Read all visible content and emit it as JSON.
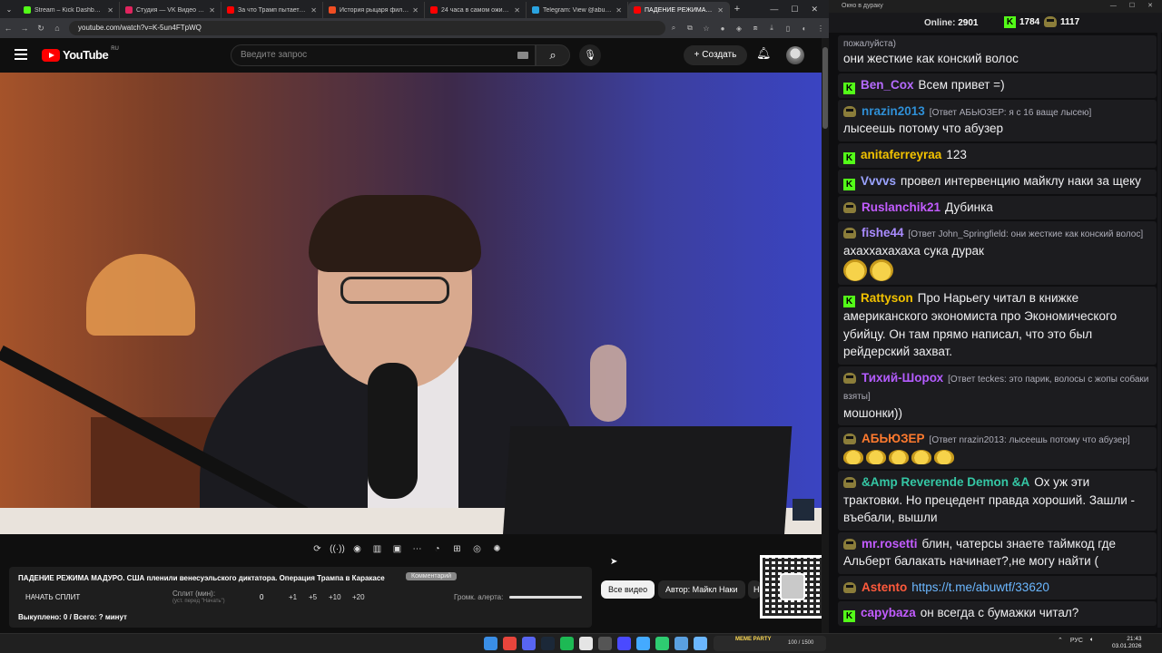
{
  "browser": {
    "tabs": [
      {
        "title": "Stream – Kick Dashboard",
        "color": "#53fc18"
      },
      {
        "title": "Студия — VK Видео Live",
        "color": "#e0245e"
      },
      {
        "title": "За что Трамп пытается убить",
        "color": "#ff0000"
      },
      {
        "title": "История рыцаря фильм, 20",
        "color": "#f04e23"
      },
      {
        "title": "24 часа в самом ожидаемом",
        "color": "#ff0000"
      },
      {
        "title": "Telegram: View @abuwtf",
        "color": "#2aa3e0"
      },
      {
        "title": "ПАДЕНИЕ РЕЖИМА МАДУ",
        "color": "#ff0000",
        "active": true
      }
    ],
    "url": "youtube.com/watch?v=K-5un4FTpWQ"
  },
  "youtube": {
    "logo_text": "YouTube",
    "region": "RU",
    "search_placeholder": "Введите запрос",
    "create_label": "Создать",
    "tools": [
      "⟳",
      "((·))",
      "◉",
      "▥",
      "▣",
      "⋯",
      "◔",
      "⊞",
      "◎",
      "✺"
    ],
    "video_title": "ПАДЕНИЕ РЕЖИМА МАДУРО. США пленили венесуэльского диктатора. Операция Трампа в Каракасе",
    "video_badge": "Комментарий",
    "split_button": "НАЧАТЬ СПЛИТ",
    "split_label": "Сплит (мин):",
    "split_sub": "(уст. перед \"Начать\")",
    "split_value": "0",
    "increments": [
      "+1",
      "+5",
      "+10",
      "+20"
    ],
    "alert_label": "Громк. алерта:",
    "alert_level": 1.0,
    "bought": "Выкуплено: 0 / Всего: ? минут",
    "chips": [
      {
        "label": "Все видео",
        "selected": true
      },
      {
        "label": "Автор: Майкл Наки",
        "selected": false
      },
      {
        "label": "Н",
        "selected": false
      }
    ]
  },
  "chat": {
    "window_title": "Окно в дураку",
    "online_label": "Online:",
    "online_count": "2901",
    "kick_count": "1784",
    "twitch_count": "1117",
    "messages": [
      {
        "platform": "",
        "user": "",
        "user_color": "#fff",
        "reply": "пожалуйста)",
        "text": "они жесткие как конский волос"
      },
      {
        "platform": "kick",
        "user": "Ben_Cox",
        "user_color": "#b66bff",
        "reply": "",
        "text": "Всем привет =)"
      },
      {
        "platform": "goblin",
        "user": "nrazin2013",
        "user_color": "#2f8fd6",
        "reply": "[Ответ АБЬЮЗЕР: я с 16 ваще лысею]",
        "text": "лысеешь потому что абузер"
      },
      {
        "platform": "kick",
        "user": "anitaferreyraa",
        "user_color": "#f2c200",
        "reply": "",
        "text": "123"
      },
      {
        "platform": "kick",
        "user": "Vvvvs",
        "user_color": "#9aa3ff",
        "reply": "",
        "text": "провел интервенцию майклу наки за щеку"
      },
      {
        "platform": "goblin",
        "user": "Ruslanchik21",
        "user_color": "#c25cff",
        "reply": "",
        "text": "Дубинка"
      },
      {
        "platform": "goblin",
        "user": "fishe44",
        "user_color": "#a98bff",
        "reply": "[Ответ John_Springfield: они жесткие как конский волос]",
        "text": "ахаххахахаха сука дурак",
        "emotes": 2
      },
      {
        "platform": "kick",
        "user": "Rattyson",
        "user_color": "#f2c200",
        "reply": "",
        "text": "Про Нарьегу читал в книжке американского экономиста про Экономического убийцу. Он там прямо написал, что это был рейдерский захват."
      },
      {
        "platform": "goblin",
        "user": "Тихий-Шорох",
        "user_color": "#b45cff",
        "reply": "[Ответ teckes: это парик, волосы с жопы собаки взяты]",
        "text": "мошонки))"
      },
      {
        "platform": "goblin",
        "user": "АБЬЮЗЕР",
        "user_color": "#ff7a2e",
        "reply": "[Ответ nrazin2013: лысеешь потому что абузер]",
        "text": "",
        "emotes_small": 5
      },
      {
        "platform": "goblin",
        "user": "&Amp Reverende Demon &A",
        "user_color": "#35c7a5",
        "reply": "",
        "text": "Ох уж эти трактовки. Но прецедент правда хороший. Зашли - въебали, вышли"
      },
      {
        "platform": "goblin",
        "user": "mr.rosetti",
        "user_color": "#c25cff",
        "reply": "",
        "text": "блин, чатерсы знаете таймкод где Альберт балакать начинает?,не могу найти ("
      },
      {
        "platform": "goblin",
        "user": "Astento",
        "user_color": "#ff5a3c",
        "reply": "",
        "text": "",
        "link": "https://t.me/abuwtf/33620"
      },
      {
        "platform": "kick",
        "user": "capybaza",
        "user_color": "#c25cff",
        "reply": "",
        "text": "он всегда с бумажки читал?"
      }
    ]
  },
  "taskbar": {
    "meme_label": "MEME PARTY",
    "meme_count": "100 / 1500",
    "lang": "РУС",
    "time": "21:43",
    "date": "03.01.2026",
    "icon_colors": [
      "#3a8ee6",
      "#e8453c",
      "#5865f2",
      "#1b2838",
      "#1db954",
      "#e5e5e5",
      "#555",
      "#4a4aff",
      "#44aaff",
      "#2ecc71",
      "#5aa0e0",
      "#6bb7ff"
    ]
  }
}
